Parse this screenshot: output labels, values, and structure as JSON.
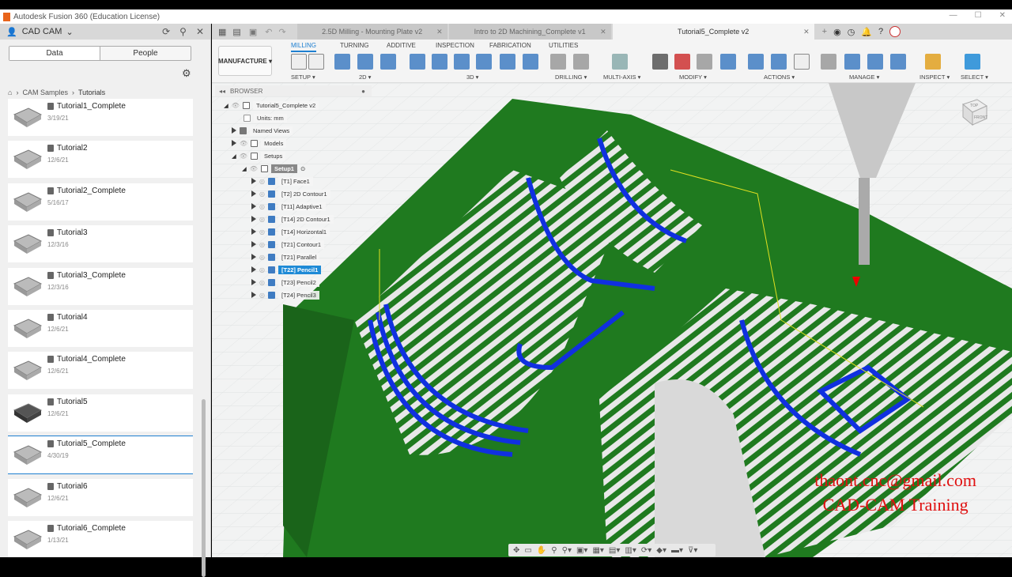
{
  "app": {
    "title": "Autodesk Fusion 360 (Education License)"
  },
  "left_panel": {
    "project": "CAD CAM",
    "tabs": [
      "Data",
      "People"
    ],
    "breadcrumb": [
      "CAM Samples",
      "Tutorials"
    ],
    "files": [
      {
        "name": "Tutorial1_Complete",
        "date": "3/19/21"
      },
      {
        "name": "Tutorial2",
        "date": "12/6/21"
      },
      {
        "name": "Tutorial2_Complete",
        "date": "5/16/17"
      },
      {
        "name": "Tutorial3",
        "date": "12/3/16"
      },
      {
        "name": "Tutorial3_Complete",
        "date": "12/3/16"
      },
      {
        "name": "Tutorial4",
        "date": "12/6/21"
      },
      {
        "name": "Tutorial4_Complete",
        "date": "12/6/21"
      },
      {
        "name": "Tutorial5",
        "date": "12/6/21"
      },
      {
        "name": "Tutorial5_Complete",
        "date": "4/30/19",
        "selected": true
      },
      {
        "name": "Tutorial6",
        "date": "12/6/21"
      },
      {
        "name": "Tutorial6_Complete",
        "date": "1/13/21"
      }
    ]
  },
  "doc_tabs": [
    {
      "label": "2.5D Milling - Mounting Plate v2"
    },
    {
      "label": "Intro to 2D Machining_Complete v1"
    },
    {
      "label": "Tutorial5_Complete v2",
      "active": true
    }
  ],
  "ribbon": {
    "workspace": "MANUFACTURE",
    "tabs": [
      "MILLING",
      "TURNING",
      "ADDITIVE",
      "INSPECTION",
      "FABRICATION",
      "UTILITIES"
    ],
    "groups": [
      "SETUP",
      "2D",
      "3D",
      "DRILLING",
      "MULTI-AXIS",
      "MODIFY",
      "ACTIONS",
      "MANAGE",
      "INSPECT",
      "SELECT"
    ]
  },
  "browser": {
    "title": "BROWSER",
    "root": "Tutorial5_Complete v2",
    "units": "Units: mm",
    "named_views": "Named Views",
    "models": "Models",
    "setups": "Setups",
    "setup": "Setup1",
    "operations": [
      "[T1] Face1",
      "[T2] 2D Contour1",
      "[T11] Adaptive1",
      "[T14] 2D Contour1",
      "[T14] Horizontal1",
      "[T21] Contour1",
      "[T21] Parallel",
      "[T22] Pencil1",
      "[T23] Pencil2",
      "[T24] Pencil3"
    ],
    "selected_index": 7
  },
  "watermark": {
    "line1": "thaont.cnc@gmail.com",
    "line2": "CAD-CAM Training"
  },
  "viewcube": {
    "top": "TOP",
    "front": "FRONT"
  },
  "colors": {
    "accent": "#1e7fd0",
    "model": "#1f7a1f",
    "toolpath": "#1030e0"
  }
}
